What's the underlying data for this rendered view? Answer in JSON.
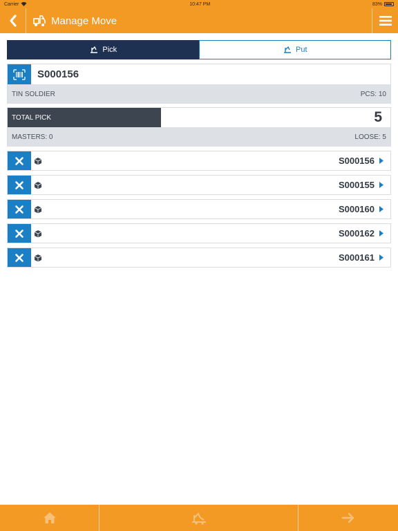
{
  "status_bar": {
    "carrier": "Carrier",
    "time": "10:47 PM",
    "battery": "83%"
  },
  "header": {
    "title": "Manage Move"
  },
  "tabs": [
    {
      "label": "Pick",
      "active": true
    },
    {
      "label": "Put",
      "active": false
    }
  ],
  "item": {
    "code": "S000156",
    "name": "TIN SOLDIER",
    "pcs": "PCS: 10"
  },
  "pick": {
    "label": "TOTAL PICK",
    "count": "5",
    "progress_fraction": 0.4,
    "masters": "MASTERS: 0",
    "loose": "LOOSE: 5"
  },
  "rows": [
    {
      "code": "S000156"
    },
    {
      "code": "S000155"
    },
    {
      "code": "S000160"
    },
    {
      "code": "S000162"
    },
    {
      "code": "S000161"
    }
  ],
  "colors": {
    "accent": "#f29a24",
    "primary": "#1a7fc4",
    "navy": "#1f3152",
    "dark": "#3d4650"
  }
}
